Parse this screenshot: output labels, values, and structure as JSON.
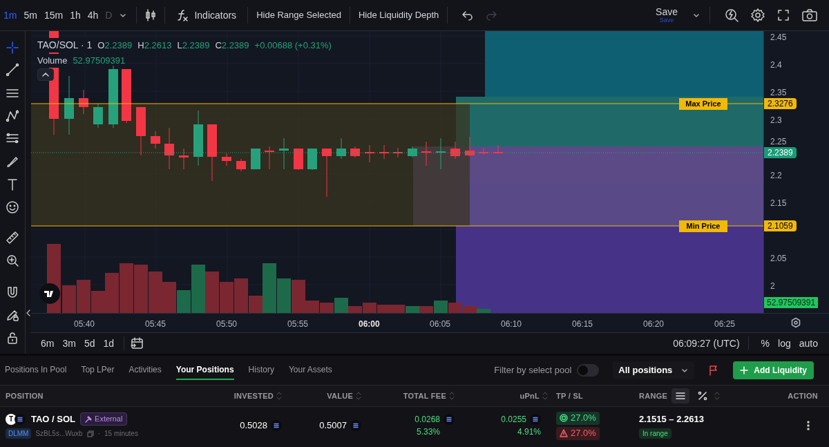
{
  "toolbar": {
    "intervals": [
      {
        "label": "1m",
        "selected": true,
        "disabled": false
      },
      {
        "label": "5m",
        "selected": false,
        "disabled": false
      },
      {
        "label": "15m",
        "selected": false,
        "disabled": false
      },
      {
        "label": "1h",
        "selected": false,
        "disabled": false
      },
      {
        "label": "4h",
        "selected": false,
        "disabled": false
      },
      {
        "label": "D",
        "selected": false,
        "disabled": true
      }
    ],
    "indicators_label": "Indicators",
    "buttons": [
      "Hide Range Selected",
      "Hide Liquidity Depth"
    ],
    "history_buttons": [
      {
        "kind": "undo",
        "disabled": false
      },
      {
        "kind": "redo",
        "disabled": true
      }
    ],
    "save": {
      "label": "Save",
      "sublabel": "Save"
    }
  },
  "legend": {
    "symbol": "TAO/SOL · 1",
    "ohlc": [
      {
        "key": "O",
        "value": "2.2389"
      },
      {
        "key": "H",
        "value": "2.2613"
      },
      {
        "key": "L",
        "value": "2.2389"
      },
      {
        "key": "C",
        "value": "2.2389"
      }
    ],
    "change": "+0.00688 (+0.31%)",
    "volume_label": "Volume",
    "volume_value": "52.97509391"
  },
  "range_lines": [
    {
      "label": "Max Price",
      "value": "2.3276"
    },
    {
      "label": "Min Price",
      "value": "2.1059"
    }
  ],
  "current_price": "2.2389",
  "volume_tag": "52.97509391",
  "price_ticks": [
    "2.45",
    "2.4",
    "2.35",
    "2.3",
    "2.25",
    "2.2",
    "2.15",
    "2.05",
    "2"
  ],
  "time_ticks": [
    {
      "label": "05:40",
      "bold": false
    },
    {
      "label": "05:45",
      "bold": false
    },
    {
      "label": "05:50",
      "bold": false
    },
    {
      "label": "05:55",
      "bold": false
    },
    {
      "label": "06:00",
      "bold": true
    },
    {
      "label": "06:05",
      "bold": false
    },
    {
      "label": "06:10",
      "bold": false
    },
    {
      "label": "06:15",
      "bold": false
    },
    {
      "label": "06:20",
      "bold": false
    },
    {
      "label": "06:25",
      "bold": false
    }
  ],
  "ranges": [
    "6m",
    "3m",
    "5d",
    "1d"
  ],
  "clock": "06:09:27 (UTC)",
  "scale_options": [
    "%",
    "log",
    "auto"
  ],
  "panel": {
    "tabs": [
      {
        "label": "Positions In Pool",
        "selected": false
      },
      {
        "label": "Top LPer",
        "selected": false
      },
      {
        "label": "Activities",
        "selected": false
      },
      {
        "label": "Your Positions",
        "selected": true
      },
      {
        "label": "History",
        "selected": false
      },
      {
        "label": "Your Assets",
        "selected": false
      }
    ],
    "filter": {
      "label": "Filter by select pool",
      "on": false
    },
    "dropdown": "All positions",
    "add_button": "Add Liquidity",
    "columns": [
      {
        "label": "POSITION",
        "sortable": false
      },
      {
        "label": "INVESTED",
        "sortable": true
      },
      {
        "label": "VALUE",
        "sortable": true
      },
      {
        "label": "TOTAL FEE",
        "sortable": true
      },
      {
        "label": "uPnL",
        "sortable": true
      },
      {
        "label": "TP / SL",
        "sortable": false
      },
      {
        "label": "RANGE",
        "sortable": true
      },
      {
        "label": "ACTION",
        "sortable": false
      }
    ],
    "range_modes": [
      {
        "kind": "list",
        "selected": true
      },
      {
        "kind": "percent",
        "selected": false
      }
    ],
    "rows": [
      {
        "token_letter": "T",
        "pair": "TAO / SOL",
        "tag": "External",
        "protocol": "DLMM",
        "address": "SzBL5s...Wuxb",
        "age_separator": "·",
        "age": "15 minutes",
        "invested": "0.5028",
        "value": "0.5007",
        "fee_amount": "0.0268",
        "fee_percent": "5.33%",
        "upnl_amount": "0.0255",
        "upnl_percent": "4.91%",
        "take_profit": "27.0%",
        "stop_loss": "27.0%",
        "range": "2.1515 – 2.2613",
        "range_status": "In range"
      }
    ]
  }
}
